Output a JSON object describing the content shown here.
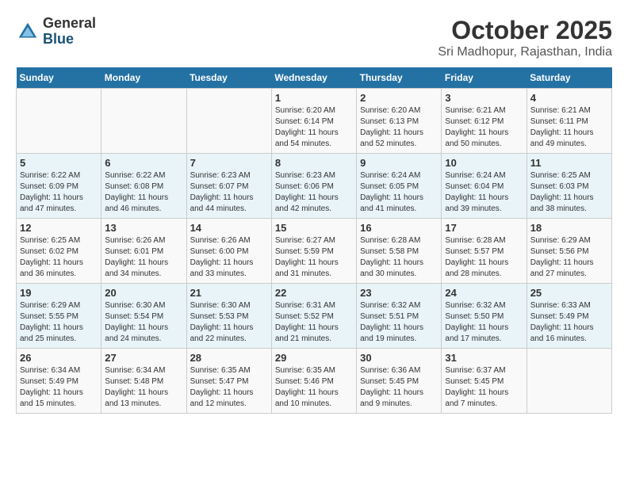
{
  "header": {
    "logo_general": "General",
    "logo_blue": "Blue",
    "month_title": "October 2025",
    "subtitle": "Sri Madhopur, Rajasthan, India"
  },
  "days_of_week": [
    "Sunday",
    "Monday",
    "Tuesday",
    "Wednesday",
    "Thursday",
    "Friday",
    "Saturday"
  ],
  "weeks": [
    [
      {
        "day": "",
        "info": ""
      },
      {
        "day": "",
        "info": ""
      },
      {
        "day": "",
        "info": ""
      },
      {
        "day": "1",
        "info": "Sunrise: 6:20 AM\nSunset: 6:14 PM\nDaylight: 11 hours\nand 54 minutes."
      },
      {
        "day": "2",
        "info": "Sunrise: 6:20 AM\nSunset: 6:13 PM\nDaylight: 11 hours\nand 52 minutes."
      },
      {
        "day": "3",
        "info": "Sunrise: 6:21 AM\nSunset: 6:12 PM\nDaylight: 11 hours\nand 50 minutes."
      },
      {
        "day": "4",
        "info": "Sunrise: 6:21 AM\nSunset: 6:11 PM\nDaylight: 11 hours\nand 49 minutes."
      }
    ],
    [
      {
        "day": "5",
        "info": "Sunrise: 6:22 AM\nSunset: 6:09 PM\nDaylight: 11 hours\nand 47 minutes."
      },
      {
        "day": "6",
        "info": "Sunrise: 6:22 AM\nSunset: 6:08 PM\nDaylight: 11 hours\nand 46 minutes."
      },
      {
        "day": "7",
        "info": "Sunrise: 6:23 AM\nSunset: 6:07 PM\nDaylight: 11 hours\nand 44 minutes."
      },
      {
        "day": "8",
        "info": "Sunrise: 6:23 AM\nSunset: 6:06 PM\nDaylight: 11 hours\nand 42 minutes."
      },
      {
        "day": "9",
        "info": "Sunrise: 6:24 AM\nSunset: 6:05 PM\nDaylight: 11 hours\nand 41 minutes."
      },
      {
        "day": "10",
        "info": "Sunrise: 6:24 AM\nSunset: 6:04 PM\nDaylight: 11 hours\nand 39 minutes."
      },
      {
        "day": "11",
        "info": "Sunrise: 6:25 AM\nSunset: 6:03 PM\nDaylight: 11 hours\nand 38 minutes."
      }
    ],
    [
      {
        "day": "12",
        "info": "Sunrise: 6:25 AM\nSunset: 6:02 PM\nDaylight: 11 hours\nand 36 minutes."
      },
      {
        "day": "13",
        "info": "Sunrise: 6:26 AM\nSunset: 6:01 PM\nDaylight: 11 hours\nand 34 minutes."
      },
      {
        "day": "14",
        "info": "Sunrise: 6:26 AM\nSunset: 6:00 PM\nDaylight: 11 hours\nand 33 minutes."
      },
      {
        "day": "15",
        "info": "Sunrise: 6:27 AM\nSunset: 5:59 PM\nDaylight: 11 hours\nand 31 minutes."
      },
      {
        "day": "16",
        "info": "Sunrise: 6:28 AM\nSunset: 5:58 PM\nDaylight: 11 hours\nand 30 minutes."
      },
      {
        "day": "17",
        "info": "Sunrise: 6:28 AM\nSunset: 5:57 PM\nDaylight: 11 hours\nand 28 minutes."
      },
      {
        "day": "18",
        "info": "Sunrise: 6:29 AM\nSunset: 5:56 PM\nDaylight: 11 hours\nand 27 minutes."
      }
    ],
    [
      {
        "day": "19",
        "info": "Sunrise: 6:29 AM\nSunset: 5:55 PM\nDaylight: 11 hours\nand 25 minutes."
      },
      {
        "day": "20",
        "info": "Sunrise: 6:30 AM\nSunset: 5:54 PM\nDaylight: 11 hours\nand 24 minutes."
      },
      {
        "day": "21",
        "info": "Sunrise: 6:30 AM\nSunset: 5:53 PM\nDaylight: 11 hours\nand 22 minutes."
      },
      {
        "day": "22",
        "info": "Sunrise: 6:31 AM\nSunset: 5:52 PM\nDaylight: 11 hours\nand 21 minutes."
      },
      {
        "day": "23",
        "info": "Sunrise: 6:32 AM\nSunset: 5:51 PM\nDaylight: 11 hours\nand 19 minutes."
      },
      {
        "day": "24",
        "info": "Sunrise: 6:32 AM\nSunset: 5:50 PM\nDaylight: 11 hours\nand 17 minutes."
      },
      {
        "day": "25",
        "info": "Sunrise: 6:33 AM\nSunset: 5:49 PM\nDaylight: 11 hours\nand 16 minutes."
      }
    ],
    [
      {
        "day": "26",
        "info": "Sunrise: 6:34 AM\nSunset: 5:49 PM\nDaylight: 11 hours\nand 15 minutes."
      },
      {
        "day": "27",
        "info": "Sunrise: 6:34 AM\nSunset: 5:48 PM\nDaylight: 11 hours\nand 13 minutes."
      },
      {
        "day": "28",
        "info": "Sunrise: 6:35 AM\nSunset: 5:47 PM\nDaylight: 11 hours\nand 12 minutes."
      },
      {
        "day": "29",
        "info": "Sunrise: 6:35 AM\nSunset: 5:46 PM\nDaylight: 11 hours\nand 10 minutes."
      },
      {
        "day": "30",
        "info": "Sunrise: 6:36 AM\nSunset: 5:45 PM\nDaylight: 11 hours\nand 9 minutes."
      },
      {
        "day": "31",
        "info": "Sunrise: 6:37 AM\nSunset: 5:45 PM\nDaylight: 11 hours\nand 7 minutes."
      },
      {
        "day": "",
        "info": ""
      }
    ]
  ]
}
